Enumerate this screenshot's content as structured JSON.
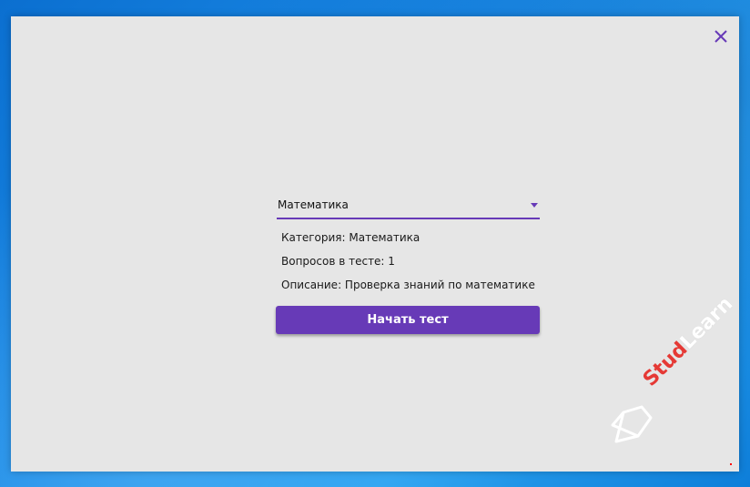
{
  "window": {
    "close_icon": "close-icon"
  },
  "test_selector": {
    "selected": "Математика"
  },
  "info": {
    "category": "Категория: Математика",
    "questions": "Вопросов в тесте: 1",
    "description": "Описание: Проверка знаний по математике"
  },
  "actions": {
    "start_label": "Начать тест"
  },
  "watermark": {
    "part1": "Stud",
    "part2": "Learn"
  },
  "colors": {
    "accent": "#673ab7",
    "window_bg": "#e6e6e6",
    "watermark_red": "#e53935"
  }
}
